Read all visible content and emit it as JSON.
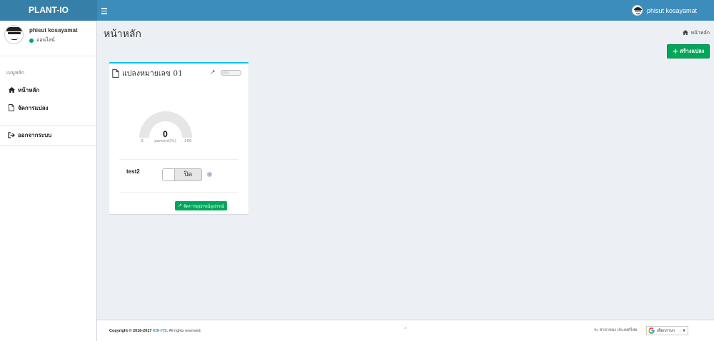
{
  "header": {
    "brand": "PLANT-IO",
    "user_name": "phisut kosayamat"
  },
  "sidebar": {
    "user_name": "phisut kosayamat",
    "status": "ออนไลน์",
    "menu_header": "เมนูหลัก",
    "items": [
      {
        "label": "หน้าหลัก",
        "icon": "home-icon"
      },
      {
        "label": "จัดการแปลง",
        "icon": "file-icon"
      },
      {
        "label": "ออกจากระบบ",
        "icon": "sign-out-icon"
      }
    ]
  },
  "main": {
    "title": "หน้าหลัก",
    "breadcrumb": "หน้าหลัก",
    "create_button": "สร้างแปลง"
  },
  "plot": {
    "title": "แปลงหมายเลข 01",
    "gauge": {
      "value": "0",
      "min": "0",
      "max": "100",
      "unit": "percent(%)",
      "fraction": 0
    },
    "device": {
      "name": "test2",
      "switch_label": "ปิด"
    },
    "manage_button": "จัดการอุปกรณ์อุปกรณ์"
  },
  "footer": {
    "copyright_prefix": "Copyright © 2016-2017 ",
    "company": "KID-ITS.",
    "rights": " All rights reserved.",
    "right_text": "ระ สาขาของ ประเทศไทย",
    "language": "เลือกภาษา"
  },
  "colors": {
    "header": "#3c8dbc",
    "brand_bg": "#367fa9",
    "success": "#00a65a",
    "box_border": "#00c0ef"
  }
}
